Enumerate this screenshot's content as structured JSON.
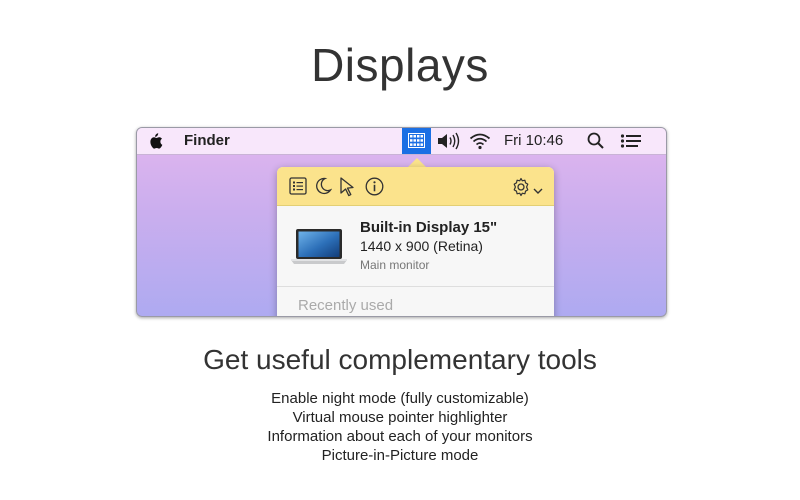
{
  "page": {
    "title": "Displays",
    "subtitle": "Get useful complementary tools",
    "features": [
      "Enable night mode (fully customizable)",
      "Virtual mouse pointer highlighter",
      "Information about each of your monitors",
      "Picture-in-Picture mode"
    ]
  },
  "menubar": {
    "app_name": "Finder",
    "clock": "Fri 10:46",
    "icons": [
      "apple-icon",
      "displays-menu-icon",
      "volume-icon",
      "wifi-icon",
      "spotlight-icon",
      "notification-center-icon"
    ],
    "highlight_color": "#1b6fe4"
  },
  "popover": {
    "toolbar_icons": [
      "display-list-icon",
      "night-mode-icon",
      "pointer-highlight-icon",
      "info-icon",
      "gear-icon",
      "chevron-down-icon"
    ],
    "toolbar_color": "#fbe38c",
    "display": {
      "name": "Built-in Display 15\"",
      "resolution": "1440 x 900 (Retina)",
      "role": "Main monitor"
    },
    "recent_label": "Recently used"
  },
  "colors": {
    "desktop_top": "#e2b6ee",
    "desktop_bottom": "#aeaaf1"
  }
}
